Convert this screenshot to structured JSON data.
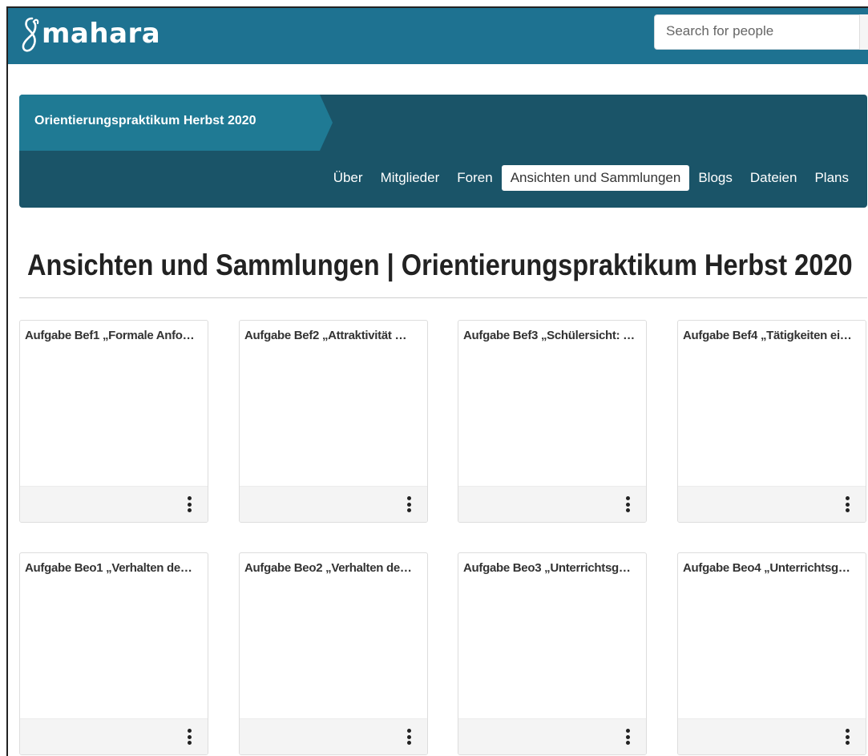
{
  "header": {
    "logo_text": "mahara",
    "search_placeholder": "Search for people"
  },
  "group": {
    "title": "Orientierungspraktikum Herbst 2020",
    "nav": [
      {
        "label": "Über",
        "active": false
      },
      {
        "label": "Mitglieder",
        "active": false
      },
      {
        "label": "Foren",
        "active": false
      },
      {
        "label": "Ansichten und Sammlungen",
        "active": true
      },
      {
        "label": "Blogs",
        "active": false
      },
      {
        "label": "Dateien",
        "active": false
      },
      {
        "label": "Plans",
        "active": false
      }
    ]
  },
  "page": {
    "title": "Ansichten und Sammlungen | Orientierungspraktikum Herbst 2020"
  },
  "cards": [
    {
      "title": "Aufgabe Bef1 „Formale Anfo…"
    },
    {
      "title": "Aufgabe Bef2 „Attraktivität …"
    },
    {
      "title": "Aufgabe Bef3 „Schülersicht: …"
    },
    {
      "title": "Aufgabe Bef4 „Tätigkeiten ei…"
    },
    {
      "title": "Aufgabe Beo1 „Verhalten de…"
    },
    {
      "title": "Aufgabe Beo2 „Verhalten de…"
    },
    {
      "title": "Aufgabe Beo3 „Unterrichtsg…"
    },
    {
      "title": "Aufgabe Beo4 „Unterrichtsg…"
    }
  ],
  "colors": {
    "topbar": "#1e7291",
    "group_header": "#1a5468",
    "group_title_tab": "#1f7a94"
  }
}
